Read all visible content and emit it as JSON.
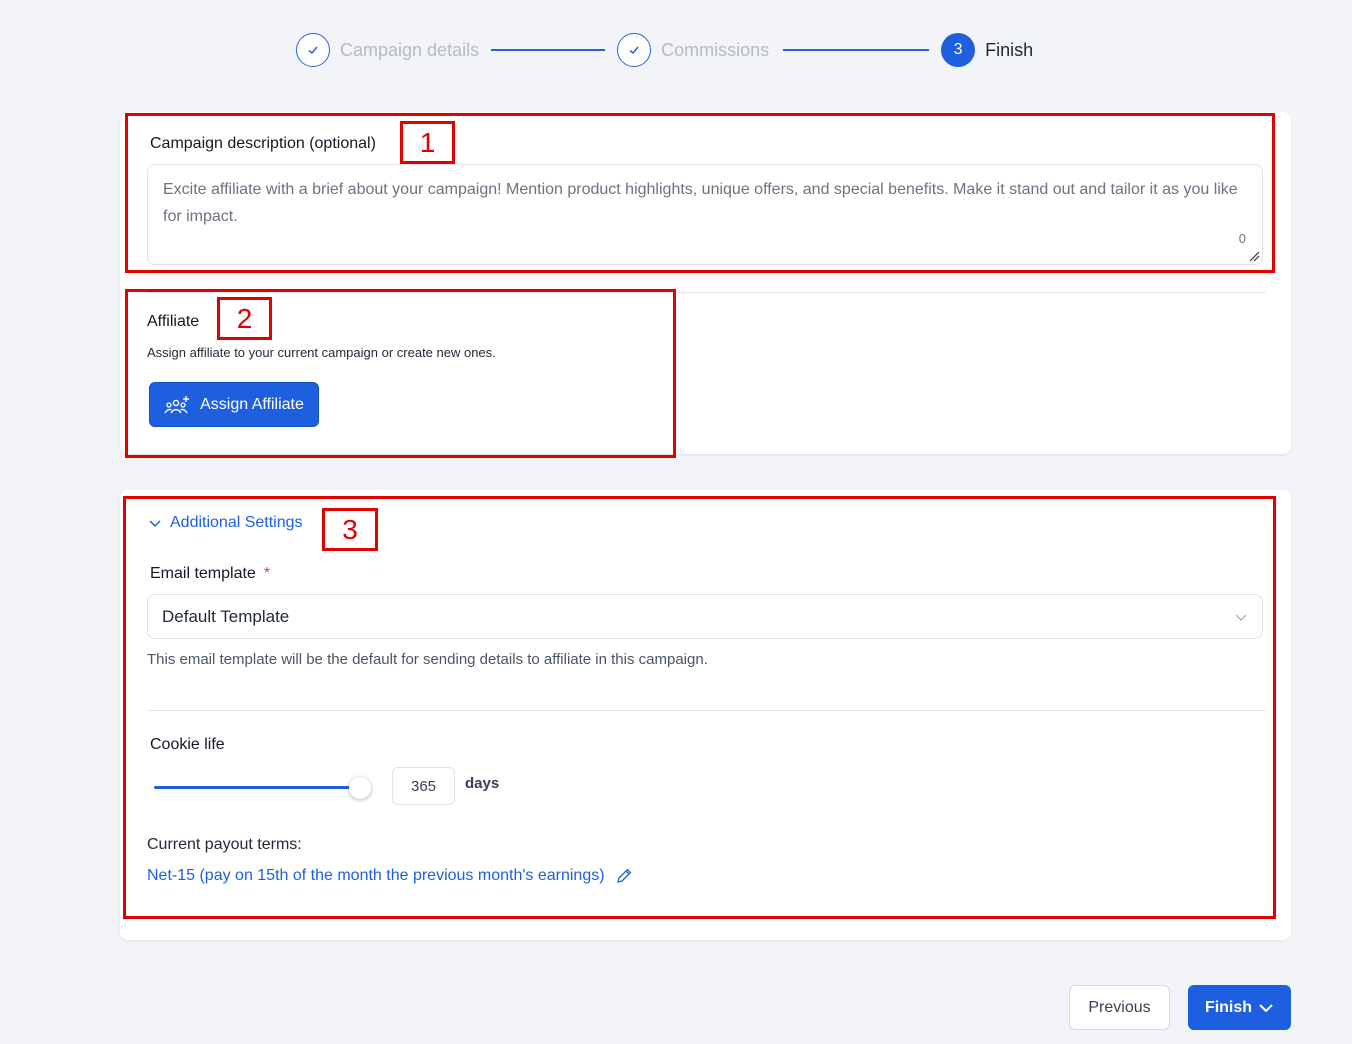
{
  "stepper": {
    "steps": [
      {
        "label": "Campaign details",
        "state": "done",
        "marker": "✓"
      },
      {
        "label": "Commissions",
        "state": "done",
        "marker": "✓"
      },
      {
        "label": "Finish",
        "state": "active",
        "marker": "3"
      }
    ]
  },
  "campaign_description": {
    "label": "Campaign description (optional)",
    "placeholder": "Excite affiliate with a brief about your campaign! Mention product highlights, unique offers, and special benefits. Make it stand out and tailor it as you like for impact.",
    "char_count": "0"
  },
  "affiliate": {
    "label": "Affiliate",
    "description": "Assign affiliate to your current campaign or create new ones.",
    "assign_button": "Assign Affiliate",
    "assign_icon": "users-plus-icon"
  },
  "additional_settings": {
    "header": "Additional Settings",
    "email_template": {
      "label": "Email template",
      "required_mark": "*",
      "selected": "Default Template",
      "helper": "This email template will be the default for sending details to affiliate in this campaign."
    },
    "cookie_life": {
      "label": "Cookie life",
      "value": "365",
      "unit": "days",
      "slider_fraction": 1.0
    },
    "payout": {
      "title": "Current payout terms:",
      "link": "Net-15 (pay on 15th of the month the previous month's earnings)",
      "edit_icon": "pencil-icon"
    }
  },
  "annotations": {
    "tag1": "1",
    "tag2": "2",
    "tag3": "3"
  },
  "footer": {
    "previous_label": "Previous",
    "finish_label": "Finish"
  },
  "colors": {
    "accent": "#1e5fe0",
    "annotation_red": "#e00000",
    "background": "#f3f4f8"
  }
}
